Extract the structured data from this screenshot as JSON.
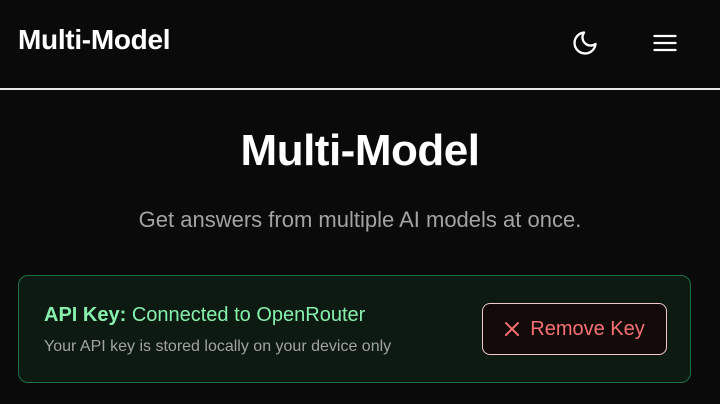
{
  "navbar": {
    "brand": "Multi-Model",
    "icons": {
      "theme": "moon-icon",
      "menu": "hamburger-menu-icon"
    }
  },
  "hero": {
    "title": "Multi-Model",
    "subtitle": "Get answers from multiple AI models at once."
  },
  "api_key_card": {
    "label": "API Key:",
    "status": "Connected to OpenRouter",
    "note": "Your API key is stored locally on your device only",
    "remove_button": {
      "icon": "close-icon",
      "label": "Remove Key"
    }
  },
  "colors": {
    "background": "#0a0a0a",
    "success": "#86efac",
    "success_border": "#1f6f45",
    "danger": "#f87171",
    "muted_text": "#a3a3a3"
  }
}
